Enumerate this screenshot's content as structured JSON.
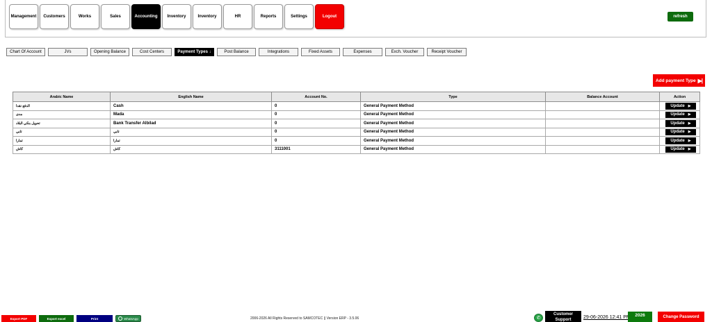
{
  "nav": {
    "items": [
      "Management",
      "Customers",
      "Works",
      "Sales",
      "Accounting",
      "Inventory",
      "Inventory",
      "HR",
      "Reports",
      "Settings",
      "Logout"
    ],
    "active": "Accounting",
    "refresh": "refresh"
  },
  "tabs": {
    "items": [
      "Chart Of Account",
      "JVs",
      "Opening Balance",
      "Cost Centers",
      "Payment Types",
      "Post Balance",
      "Integrations",
      "Fixed Assets",
      "Expenses",
      "Exch. Voucher",
      "Receipt Voucher"
    ],
    "active": "Payment Types",
    "active_suffix": "↓"
  },
  "add_button": {
    "label": "Add payment Type",
    "icon": "skip-forward-icon"
  },
  "table": {
    "headers": [
      "Arabic Name",
      "English Name",
      "Account No.",
      "Type",
      "Balance Account",
      "Action"
    ],
    "rows": [
      {
        "arabic": "الدفع نقدا",
        "english": "Cash",
        "account": "0",
        "type": "General Payment Method",
        "balance": "",
        "action": "Update"
      },
      {
        "arabic": "مدى",
        "english": "Mada",
        "account": "0",
        "type": "General Payment Method",
        "balance": "",
        "action": "Update"
      },
      {
        "arabic": "تحويل بنكي البلاد",
        "english": "Bank Transfer Albilad",
        "account": "0",
        "type": "General Payment Method",
        "balance": "",
        "action": "Update"
      },
      {
        "arabic": "تابي",
        "english": "تابي",
        "account": "0",
        "type": "General Payment Method",
        "balance": "",
        "action": "Update"
      },
      {
        "arabic": "تمارا",
        "english": "تمارا",
        "account": "0",
        "type": "General Payment Method",
        "balance": "",
        "action": "Update"
      },
      {
        "arabic": "كاش",
        "english": "كاش",
        "account": "3111001",
        "type": "General Payment Method",
        "balance": "",
        "action": "Update"
      }
    ]
  },
  "footer": {
    "export_pdf": "Export PDF",
    "export_excel": "Export excel",
    "print": "Print",
    "whatsapp": "WhatsApp",
    "copyright": "2006-2026 All Rights Reserved to SAMCOTEC || Version ERP - 3.5.06",
    "support": "Customer Support",
    "datetime": "29-06-2026 12:41 PM",
    "year": "2026",
    "change_password": "Change Password"
  },
  "colors": {
    "logout": "#f30000",
    "refresh": "#0d6b0d",
    "add_button": "#f30000",
    "export_pdf": "#f30000",
    "export_excel": "#0d6b0d",
    "print": "#000080",
    "whatsapp": "#2a8a4a",
    "year": "#0d7a0d",
    "change_password": "#f30000"
  }
}
